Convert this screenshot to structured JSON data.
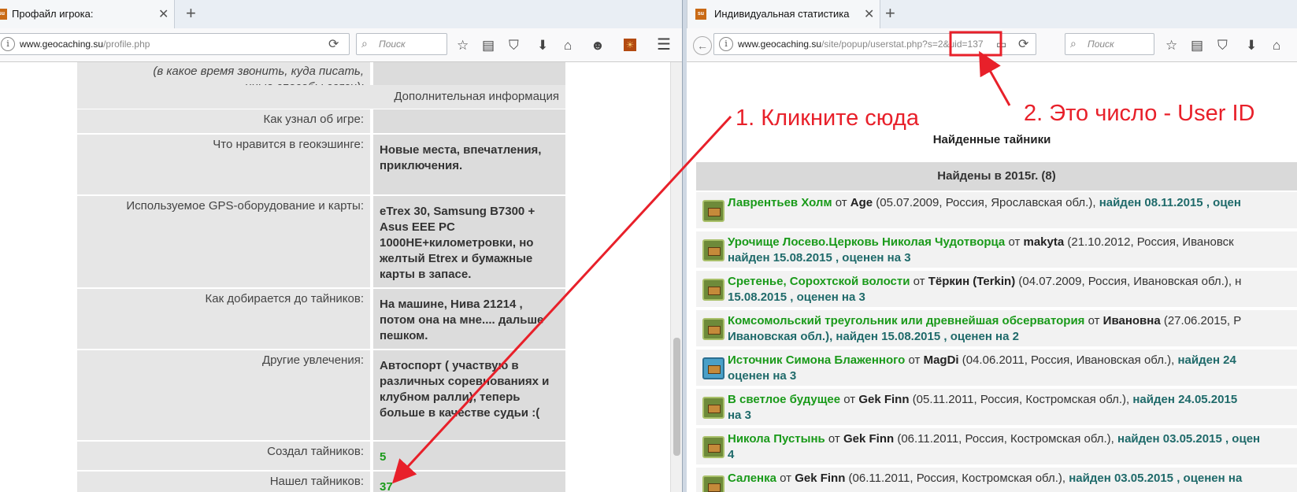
{
  "left_window": {
    "tab_title": "Профайл игрока:",
    "url_domain": "www.geocaching.su",
    "url_path": "/profile.php",
    "search_placeholder": "Поиск",
    "contact_hint_line1": "(в какое время звонить, куда писать,",
    "contact_hint_line2": "иные способы связи):",
    "section_title": "Дополнительная информация",
    "rows": [
      {
        "label": "Как узнал об игре:",
        "value": ""
      },
      {
        "label": "Что нравится в геокэшинге:",
        "value": "Новые места, впечатления, приключения."
      },
      {
        "label": "Используемое GPS-оборудование и карты:",
        "value": "eTrex 30, Samsung B7300 + Asus EEE PC 1000HE+километровки, но желтый Etrex и бумажные карты в запасе."
      },
      {
        "label": "Как добирается до тайников:",
        "value": "На машине, Нива 21214 , потом она на мне.... дальше пешком."
      },
      {
        "label": "Другие увлечения:",
        "value": "Автоспорт ( участвую в различных соревнованиях и клубном ралли), теперь больше в качестве судьи :("
      },
      {
        "label": "Создал тайников:",
        "value": "5"
      },
      {
        "label": "Нашел тайников:",
        "value": "37"
      }
    ]
  },
  "right_window": {
    "tab_title": "Индивидуальная статистика",
    "url_domain": "www.geocaching.su",
    "url_path": "/site/popup/userstat.php?s=2&uid=137",
    "search_placeholder": "Поиск",
    "page_heading": "Найденные тайники",
    "year_header": "Найдены в 2015г. (8)",
    "entries": [
      {
        "name": "Лаврентьев Холм",
        "owner": "Age",
        "meta": "(05.07.2009, Россия, Ярославская обл.),",
        "found": "найден 08.11.2015 , оцен",
        "line2": ""
      },
      {
        "name": "Урочище Лосево.Церковь Николая Чудотворца",
        "owner": "makyta",
        "meta": "(21.10.2012, Россия, Ивановск",
        "found": "",
        "line2": "найден 15.08.2015 , оценен на 3"
      },
      {
        "name": "Сретенье, Сорохтской волости",
        "owner": "Тёркин (Terkin)",
        "meta": "(04.07.2009, Россия, Ивановская обл.), н",
        "found": "",
        "line2": "15.08.2015 , оценен на 3"
      },
      {
        "name": "Комсомольский треугольник или древнейшая обсерватория",
        "owner": "Ивановна",
        "meta": "(27.06.2015, Р",
        "found": "",
        "line2": "Ивановская обл.), найден 15.08.2015 , оценен на 2"
      },
      {
        "name": "Источник Симона Блаженного",
        "owner": "MagDi",
        "meta": "(04.06.2011, Россия, Ивановская обл.),",
        "found": "найден 24",
        "line2": "оценен на 3"
      },
      {
        "name": "В светлое будущее",
        "owner": "Gek Finn",
        "meta": "(05.11.2011, Россия, Костромская обл.),",
        "found": "найден 24.05.2015",
        "line2": "на 3"
      },
      {
        "name": "Никола Пустынь",
        "owner": "Gek Finn",
        "meta": "(06.11.2011, Россия, Костромская обл.),",
        "found": "найден 03.05.2015 , оцен",
        "line2": "4"
      },
      {
        "name": "Саленка",
        "owner": "Gek Finn",
        "meta": "(06.11.2011, Россия, Костромская обл.),",
        "found": "найден 03.05.2015 , оценен на",
        "line2": ""
      }
    ]
  },
  "annotations": {
    "step1": "1. Кликните сюда",
    "step2": "2. Это число - User ID",
    "color": "#e8202a"
  },
  "labels": {
    "from": "от"
  }
}
